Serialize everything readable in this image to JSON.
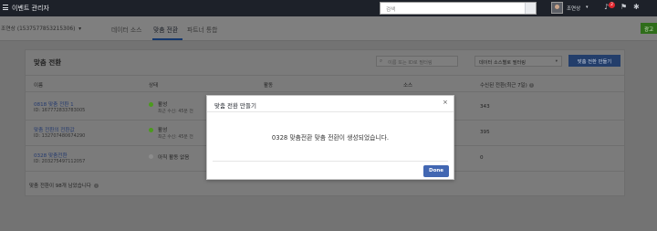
{
  "topbar": {
    "app_title": "이벤트 관리자",
    "search_placeholder": "검색",
    "user_name": "조연상",
    "notification_count": "2"
  },
  "subbar": {
    "account_selector": "조연상 (1537577853215306)",
    "tabs": [
      {
        "label": "데이터 소스",
        "active": false
      },
      {
        "label": "맞춤 전환",
        "active": true
      },
      {
        "label": "파트너 통합",
        "active": false
      }
    ],
    "right_button": "광고"
  },
  "card": {
    "title": "맞춤 전환",
    "search_placeholder": "이름 또는 ID로 필터링",
    "filter_label": "데이터 소스별로 필터링",
    "create_button": "맞춤 전환 만들기",
    "columns": {
      "name": "이름",
      "status": "상태",
      "activity": "활동",
      "source": "소스",
      "received": "수신된 전환(최근 7일)"
    },
    "rows": [
      {
        "name": "0818 맞춤 전환 1",
        "id": "ID: 167772833783005",
        "status": "활성",
        "status_sub": "최근 수신: 45분 전",
        "status_color": "#4b9a1d",
        "count": "343"
      },
      {
        "name": "맞춤 전환의 전환값",
        "id": "ID: 132707480674290",
        "status": "활성",
        "status_sub": "최근 수신: 45분 전",
        "status_color": "#4b9a1d",
        "count": "395"
      },
      {
        "name": "0328 맞춤전환",
        "id": "ID: 203275497112057",
        "status": "아직 활동 없음",
        "status_sub": "",
        "status_color": "#8c8c8c",
        "count": "0"
      }
    ],
    "footer": "맞춤 전환이 98개 남았습니다"
  },
  "modal": {
    "title": "맞춤 전환 만들기",
    "message": "0328 맞춤전환 맞춤 전환이 생성되었습니다.",
    "done_button": "Done"
  }
}
